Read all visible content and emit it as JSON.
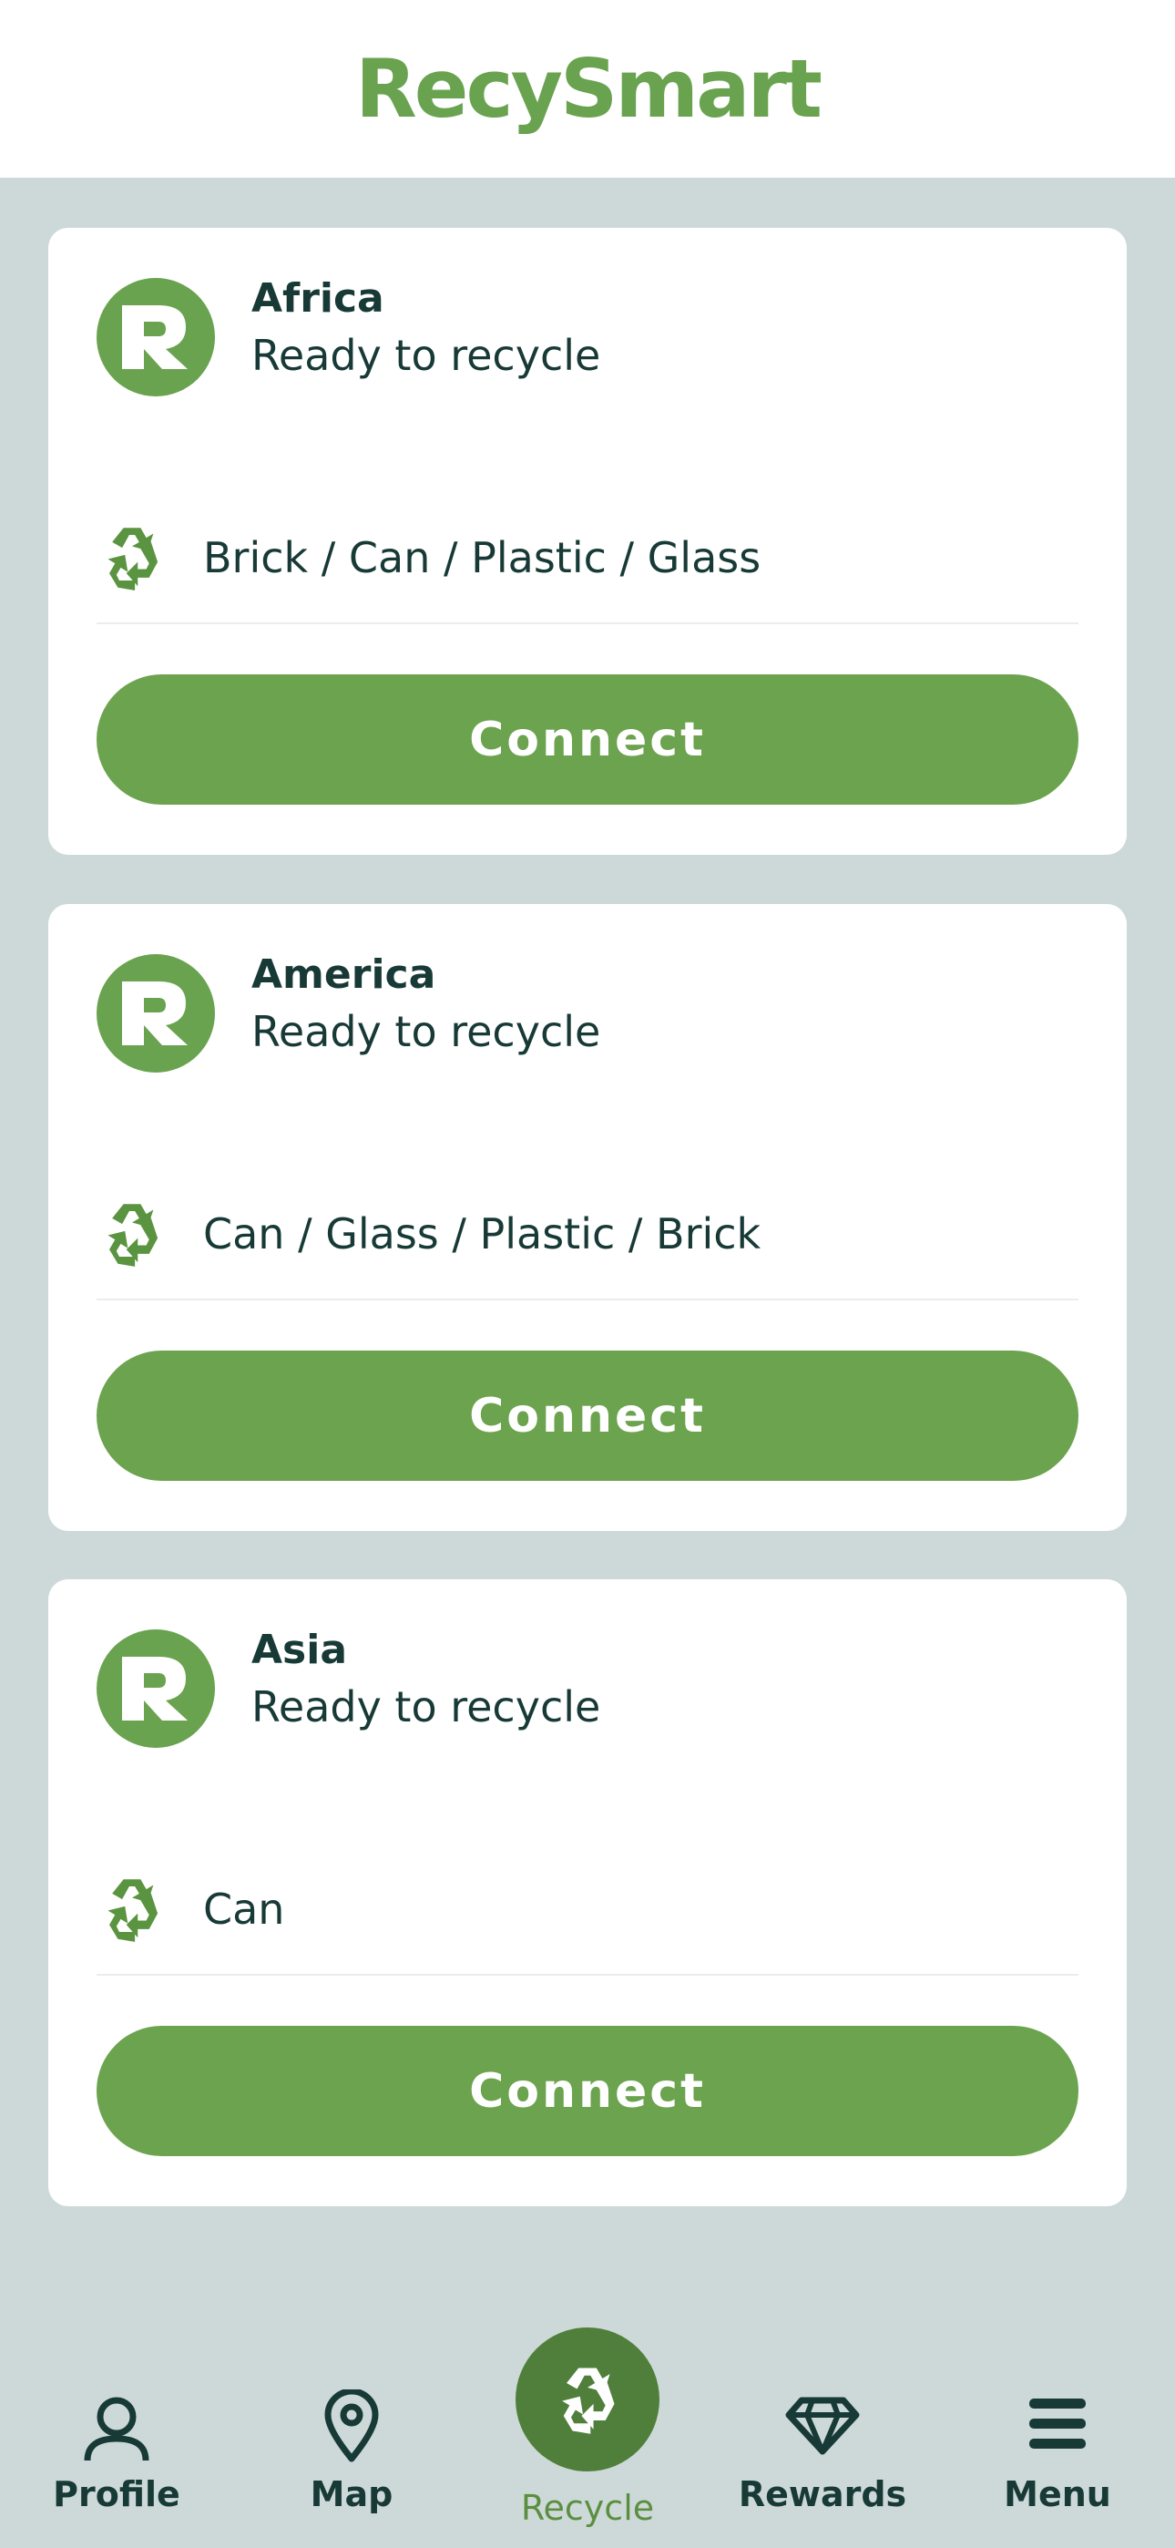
{
  "app": {
    "logo": "RecySmart"
  },
  "colors": {
    "brand_green": "#6aa34f",
    "dark_text": "#183a37",
    "background": "#cdd9d9",
    "active_nav": "#4f7f3a"
  },
  "cards": [
    {
      "title": "Africa",
      "status": "Ready to recycle",
      "materials": "Brick / Can / Plastic / Glass",
      "button": "Connect"
    },
    {
      "title": "America",
      "status": "Ready to recycle",
      "materials": "Can / Glass / Plastic / Brick",
      "button": "Connect"
    },
    {
      "title": "Asia",
      "status": "Ready to recycle",
      "materials": "Can",
      "button": "Connect"
    }
  ],
  "nav": {
    "items": [
      {
        "label": "Profile",
        "icon": "user-icon"
      },
      {
        "label": "Map",
        "icon": "map-pin-icon"
      },
      {
        "label": "Recycle",
        "icon": "recycle-icon",
        "active": true
      },
      {
        "label": "Rewards",
        "icon": "diamond-icon"
      },
      {
        "label": "Menu",
        "icon": "menu-icon"
      }
    ]
  }
}
